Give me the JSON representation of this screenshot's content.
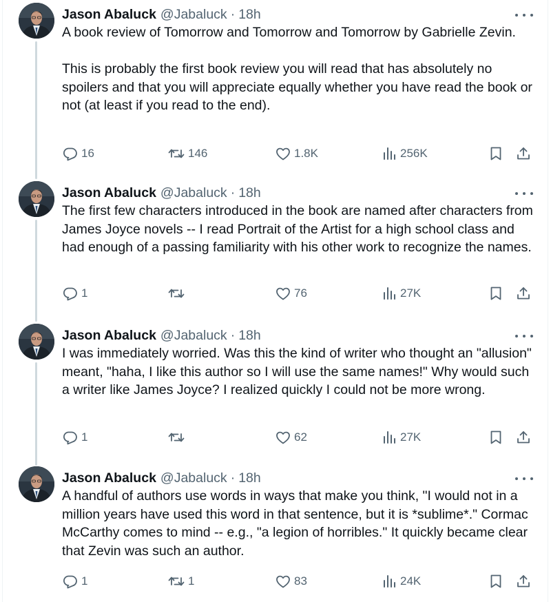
{
  "tweets": [
    {
      "author": "Jason Abaluck",
      "handle": "@Jabaluck",
      "separator": "·",
      "time": "18h",
      "paragraphs": [
        "A book review of Tomorrow and Tomorrow and Tomorrow by Gabrielle Zevin.",
        "This is probably the first book review you will read that has absolutely no spoilers and that you will appreciate equally whether you have read the book or not (at least if you read to the end)."
      ],
      "replies": "16",
      "retweets": "146",
      "likes": "1.8K",
      "views": "256K"
    },
    {
      "author": "Jason Abaluck",
      "handle": "@Jabaluck",
      "separator": "·",
      "time": "18h",
      "paragraphs": [
        "The first few characters introduced in the book are named after characters from James Joyce novels -- I read Portrait of the Artist for a high school class and had enough of a passing familiarity with his other work to recognize the names."
      ],
      "replies": "1",
      "retweets": "",
      "likes": "76",
      "views": "27K"
    },
    {
      "author": "Jason Abaluck",
      "handle": "@Jabaluck",
      "separator": "·",
      "time": "18h",
      "paragraphs": [
        "I was immediately worried. Was this the kind of writer who thought an \"allusion\" meant, \"haha, I like this author so I will use the same names!\" Why would such a writer like James Joyce? I realized quickly I could not be more wrong."
      ],
      "replies": "1",
      "retweets": "",
      "likes": "62",
      "views": "27K"
    },
    {
      "author": "Jason Abaluck",
      "handle": "@Jabaluck",
      "separator": "·",
      "time": "18h",
      "paragraphs": [
        "A handful of authors use words in ways that make you think, \"I would not in a million years have used this word in that sentence, but it is *sublime*.\" Cormac McCarthy comes to mind -- e.g., \"a legion of horribles.\" It quickly became clear that Zevin was such an author."
      ],
      "replies": "1",
      "retweets": "1",
      "likes": "83",
      "views": "24K"
    }
  ],
  "icons": {
    "reply": "reply-icon",
    "retweet": "retweet-icon",
    "like": "like-icon",
    "views": "views-icon",
    "bookmark": "bookmark-icon",
    "share": "share-icon",
    "more": "more-icon"
  },
  "colors": {
    "text": "#0f1419",
    "secondary": "#536471",
    "thread_line": "#cfd9de"
  }
}
